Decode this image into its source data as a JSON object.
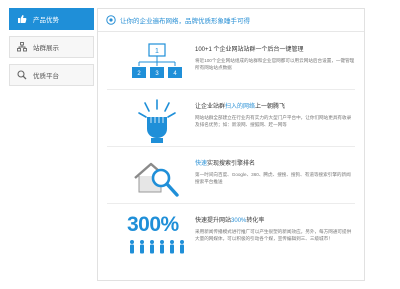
{
  "sidebar": {
    "items": [
      {
        "label": "产品优势",
        "icon": "thumbs-up-icon",
        "active": true
      },
      {
        "label": "站群展示",
        "icon": "network-icon",
        "active": false
      },
      {
        "label": "优质平台",
        "icon": "search-icon",
        "active": false
      }
    ]
  },
  "banner": {
    "text": "让你的企业遍布网络，品牌优质形象睡手可得"
  },
  "features": [
    {
      "icon": "multi-site-icon",
      "art_labels": [
        "1",
        "2",
        "3",
        "4"
      ],
      "title_parts": [
        "100+1 个企业网站站群一个后台一键管理"
      ],
      "description": "将近100个企业网站组成的站群和企业官网都可以用云网站后台设置，一键管理所有网站站点数据"
    },
    {
      "icon": "fist-icon",
      "title_pre": "让企业站群",
      "title_hl": "扫入的网络",
      "title_post": "上一朝腾飞",
      "description": "网站站群全部建立在行业内有实力的大型门户平台中，让你们网站更具有收录及排名优势；如：新浪网、搜狐网、赶一网等"
    },
    {
      "icon": "house-search-icon",
      "title_hl": "快速",
      "title_post": "实现搜索引擎排名",
      "description": "第一时间向百度、Google、360、腾虎、搜搜、搜狗、有道等搜索引擎的新闻搜索平台推送"
    },
    {
      "icon": "people-growth-icon",
      "art_text": "300%",
      "title_pre": "快速提升网站",
      "title_hl": "300%",
      "title_post": "转化率",
      "description": "采用新闻传播模式进行推广可以产生很塑的新闻效应。另外，每方网通可提供大量的网媒体，可以积极的引动各个媒，宣传编辑到三、三级城市！"
    }
  ],
  "colors": {
    "accent": "#1f8fd8",
    "text": "#333333",
    "muted": "#777777"
  }
}
